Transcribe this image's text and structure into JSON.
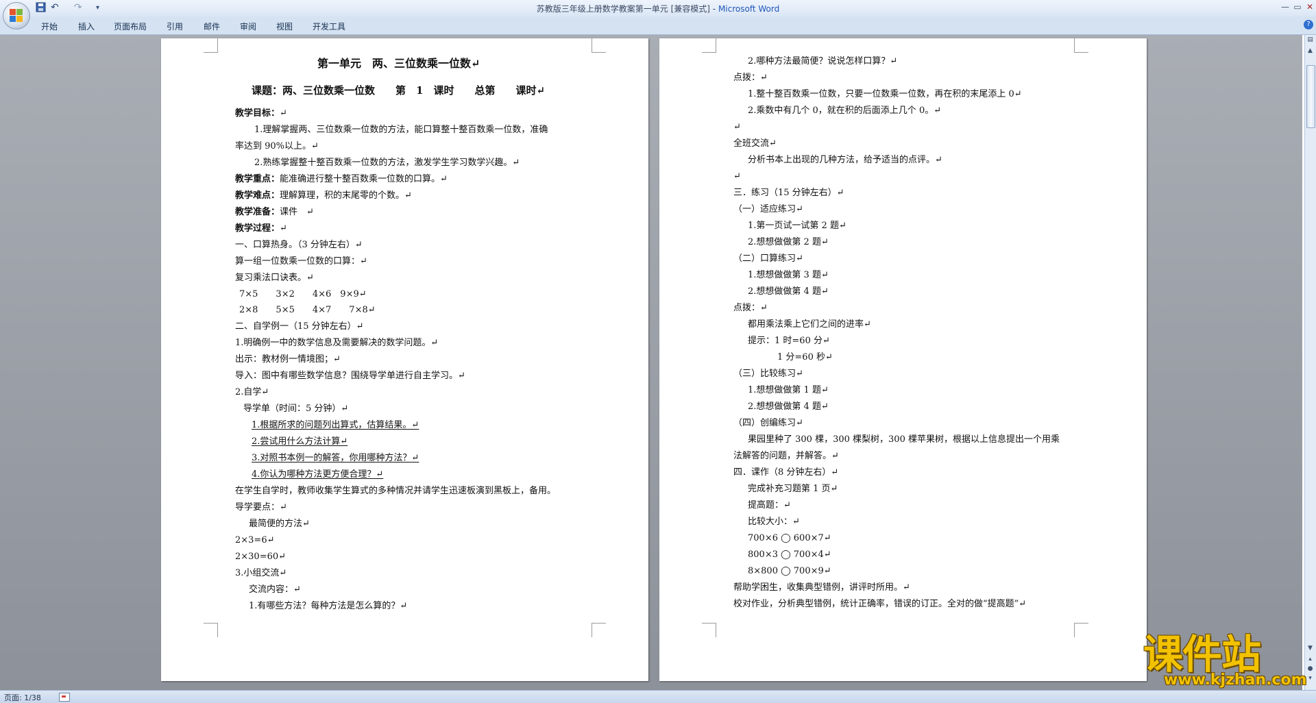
{
  "window": {
    "doc_title": "苏教版三年级上册数学教案第一单元 [兼容模式]",
    "title_sep": " - ",
    "app_name": "Microsoft Word"
  },
  "quick_access": {
    "undo": "↶",
    "redo": "↷",
    "more": "▾"
  },
  "window_controls": {
    "minimize": "—",
    "restore": "▭",
    "close": "✕"
  },
  "ribbon": {
    "tabs": [
      "开始",
      "插入",
      "页面布局",
      "引用",
      "邮件",
      "审阅",
      "视图",
      "开发工具"
    ],
    "help": "?"
  },
  "page1": {
    "title": "第一单元　两、三位数乘一位数↵",
    "subtitle": "课题：两、三位数乘一位数　　第　1　课时　　总第　　课时↵",
    "goal_label": "教学目标：",
    "goal_rest": "↵",
    "goal1a": "1.理解掌握两、三位数乘一位数的方法，能口算整十整百数乘一位数，准确",
    "goal1b": "率达到 90%以上。↵",
    "goal2": "2.熟练掌握整十整百数乘一位数的方法，激发学生学习数学兴趣。↵",
    "key_label": "教学重点：",
    "key_rest": "能准确进行整十整百数乘一位数的口算。↵",
    "diff_label": "教学难点：",
    "diff_rest": "理解算理，积的末尾零的个数。↵",
    "prep_label": "教学准备：",
    "prep_rest": "课件　↵",
    "proc_label": "教学过程：",
    "proc_rest": "↵",
    "s1": "一、口算热身。（3 分钟左右）↵",
    "s1a": "算一组一位数乘一位数的口算：↵",
    "s1b": "复习乘法口诀表。↵",
    "calc1": "7×5　　3×2　　4×6　9×9↵",
    "calc2": "2×8　　5×5　　4×7　　7×8↵",
    "s2": "二、自学例一（15 分钟左右）↵",
    "s2a": "1.明确例一中的数学信息及需要解决的数学问题。↵",
    "s2b": "出示：教材例一情境图；↵",
    "s2c": "导入：图中有哪些数学信息？围绕导学单进行自主学习。↵",
    "s2d": "2.自学↵",
    "s2e": "导学单（时间：5 分钟）↵",
    "q1": "1.根据所求的问题列出算式，估算结果。↵",
    "q2": "2.尝试用什么方法计算↵",
    "q3": "3.对照书本例一的解答，你用哪种方法？↵",
    "q4": "4.你认为哪种方法更方便合理？↵",
    "s2f": "在学生自学时，教师收集学生算式的多种情况并请学生迅速板演到黑板上，备用。",
    "s2g": "导学要点：↵",
    "s2h": "最简便的方法↵",
    "e1": "2×3=6↵",
    "e2": "2×30=60↵",
    "s3": "3.小组交流↵",
    "s3a": "交流内容：↵",
    "s3b": "1.有哪些方法？每种方法是怎么算的？↵"
  },
  "page2": {
    "l01": "2.哪种方法最简便？说说怎样口算？↵",
    "l02": "点拨：↵",
    "l03": "1.整十整百数乘一位数，只要一位数乘一位数，再在积的末尾添上 0↵",
    "l04": "2.乘数中有几个 0，就在积的后面添上几个 0。↵",
    "l05": "↵",
    "l06": "全班交流↵",
    "l07": "分析书本上出现的几种方法，给予适当的点评。↵",
    "l08": "↵",
    "l09": "三．练习（15 分钟左右）↵",
    "l10": "（一）适应练习↵",
    "l11": "1.第一页试一试第 2 题↵",
    "l12": "2.想想做做第 2 题↵",
    "l13": "（二）口算练习↵",
    "l14": "1.想想做做第 3 题↵",
    "l15": "2.想想做做第 4 题↵",
    "l16": "点拨：↵",
    "l17": "都用乘法乘上它们之间的进率↵",
    "l18": "提示：1 时=60 分↵",
    "l19": "1 分=60 秒↵",
    "l20": "（三）比较练习↵",
    "l21": "1.想想做做第 1 题↵",
    "l22": "2.想想做做第 4 题↵",
    "l23": "（四）创编练习↵",
    "l24a": "果园里种了 300 棵，300 棵梨树，300 棵苹果树，根据以上信息提出一个用乘",
    "l24b": "法解答的问题，并解答。↵",
    "l25": "四．课作（8 分钟左右）↵",
    "l26": "完成补充习题第 1 页↵",
    "l27": "提高题：↵",
    "l28": "比较大小：↵",
    "l29": "700×6 ◯ 600×7↵",
    "l30": "800×3 ◯ 700×4↵",
    "l31": "8×800 ◯ 700×9↵",
    "l32": "帮助学困生，收集典型错例，讲评时所用。↵",
    "l33": "校对作业，分析典型错例，统计正确率，错误的订正。全对的做“提高题”↵"
  },
  "status": {
    "page_info": "页面: 1/38"
  },
  "watermark": {
    "brand": "课件站",
    "url": "www.kjzhan.com"
  },
  "colors": {
    "ribbon_bg": "#d5e2f2",
    "canvas_bg": "#9a9ea5",
    "app_name": "#1f56b8",
    "watermark": "#f2c200"
  }
}
